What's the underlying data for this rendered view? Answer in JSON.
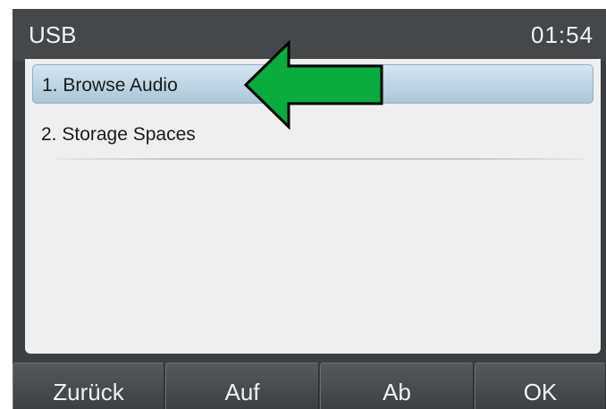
{
  "header": {
    "title": "USB",
    "time": "01:54"
  },
  "menu": {
    "items": [
      {
        "label": "1. Browse Audio",
        "selected": true
      },
      {
        "label": "2. Storage Spaces",
        "selected": false
      }
    ]
  },
  "softkeys": [
    {
      "label": "Zurück"
    },
    {
      "label": "Auf"
    },
    {
      "label": "Ab"
    },
    {
      "label": "OK"
    }
  ],
  "colors": {
    "arrow_fill": "#0aab3f",
    "selected_highlight": "#abc6d8",
    "header_background": "#44484b"
  },
  "icons": [
    "pointer-arrow-icon"
  ]
}
